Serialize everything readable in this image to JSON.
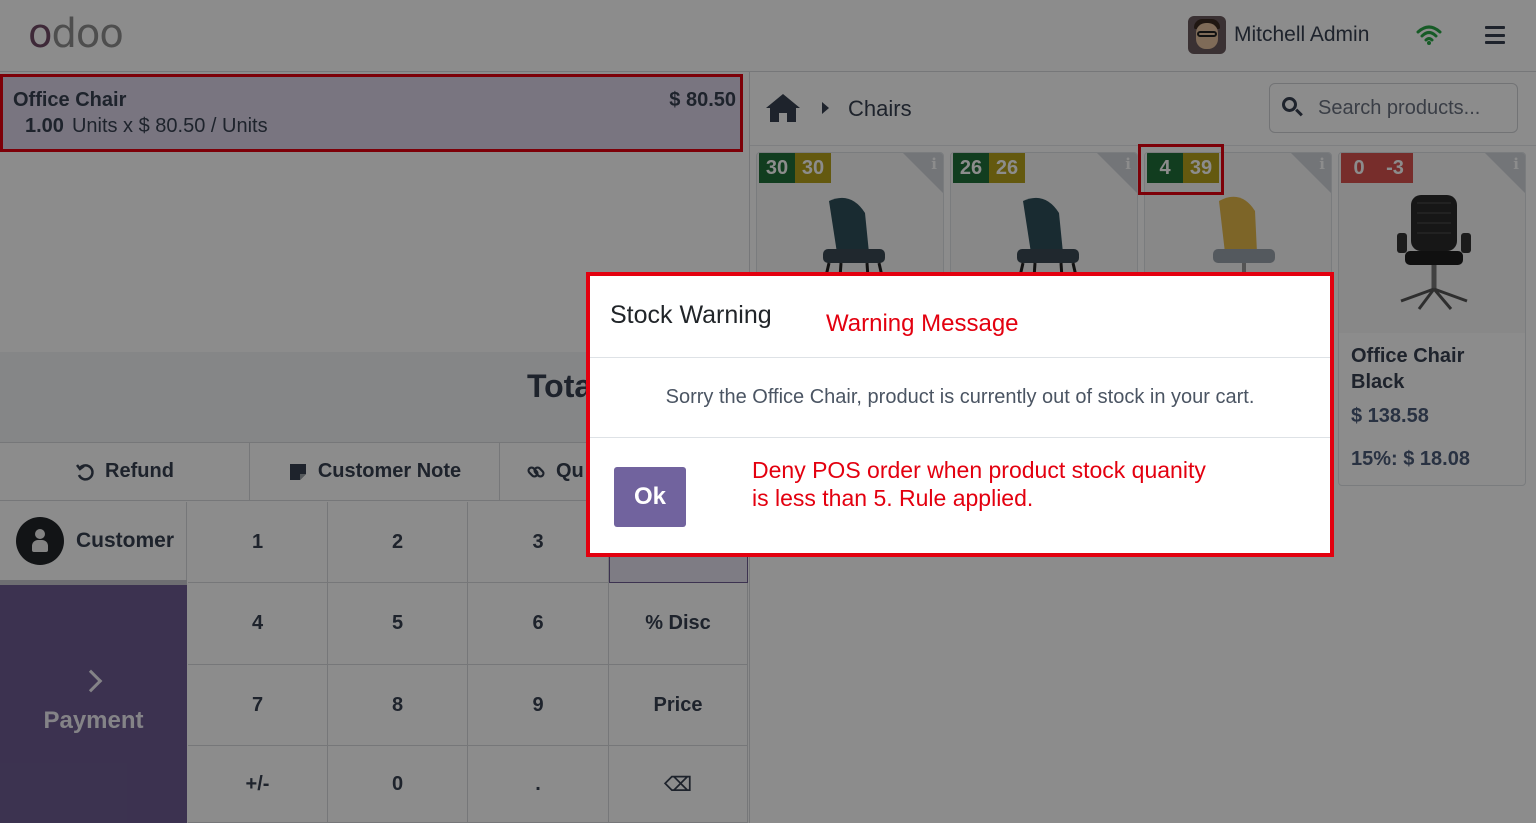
{
  "topbar": {
    "logo": "odoo",
    "user_name": "Mitchell Admin"
  },
  "order": {
    "line": {
      "name": "Office Chair",
      "price": "$ 80.50",
      "qty": "1.00",
      "unit_text": "Units x $ 80.50 / Units"
    },
    "total_label": "Tota"
  },
  "controls": {
    "refund": "Refund",
    "customer_note": "Customer Note",
    "quantity_partial": "Qu"
  },
  "customer_label": "Customer",
  "payment_label": "Payment",
  "numpad": {
    "keys": [
      "1",
      "2",
      "3",
      "",
      "4",
      "5",
      "6",
      "% Disc",
      "7",
      "8",
      "9",
      "Price",
      "+/-",
      "0",
      ".",
      "⌫"
    ]
  },
  "catalog": {
    "breadcrumb": "Chairs",
    "search_placeholder": "Search products...",
    "products": [
      {
        "badge_a": "30",
        "badge_b": "30",
        "badge_b_color": "olive"
      },
      {
        "badge_a": "26",
        "badge_b": "26",
        "badge_b_color": "olive"
      },
      {
        "badge_a": "4",
        "badge_b": "39",
        "badge_b_color": "olive"
      },
      {
        "badge_a": "0",
        "badge_b": "-3",
        "badge_b_color": "red",
        "name": "Office Chair Black",
        "price": "$ 138.58",
        "discount": "15%: $ 18.08"
      }
    ]
  },
  "dialog": {
    "title": "Stock Warning",
    "annotation_top": "Warning Message",
    "message": "Sorry the Office Chair, product is currently out of stock in your cart.",
    "ok_label": "Ok",
    "annotation_line1": "Deny POS order when product stock quanity",
    "annotation_line2": "is less than 5. Rule applied."
  },
  "colors": {
    "brand": "#714B67",
    "payment": "#6e5c92",
    "ok_button": "#71639e",
    "annotation_red": "#e3000f",
    "stock_green": "#1f6f3a",
    "stock_olive": "#b7a21c",
    "stock_red": "#d9534f"
  }
}
